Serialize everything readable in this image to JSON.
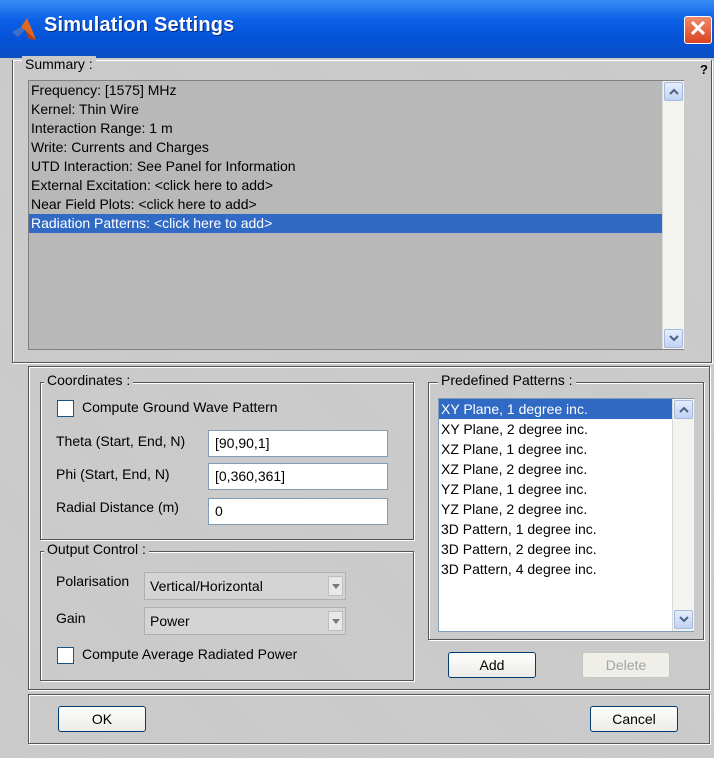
{
  "window": {
    "title": "Simulation Settings",
    "close_glyph": "✕"
  },
  "summary": {
    "legend": "Summary :",
    "help_glyph": "?",
    "items": [
      "Frequency: [1575] MHz",
      "Kernel: Thin Wire",
      "Interaction Range: 1 m",
      "Write: Currents and Charges",
      "UTD Interaction: See Panel for Information",
      "External Excitation: <click here to add>",
      "Near Field Plots: <click here to add>",
      "Radiation Patterns: <click here to add>"
    ],
    "selected_index": 7
  },
  "coordinates": {
    "legend": "Coordinates :",
    "ground_wave_label": "Compute Ground Wave Pattern",
    "theta_label": "Theta (Start, End, N)",
    "theta_value": "[90,90,1]",
    "phi_label": "Phi (Start, End, N)",
    "phi_value": "[0,360,361]",
    "radial_label": "Radial Distance (m)",
    "radial_value": "0"
  },
  "output_control": {
    "legend": "Output Control :",
    "polarisation_label": "Polarisation",
    "polarisation_value": "Vertical/Horizontal",
    "gain_label": "Gain",
    "gain_value": "Power",
    "avg_power_label": "Compute Average Radiated Power"
  },
  "predefined": {
    "legend": "Predefined Patterns :",
    "items": [
      "XY Plane, 1 degree inc.",
      "XY Plane, 2 degree inc.",
      "XZ Plane, 1 degree inc.",
      "XZ Plane, 2 degree inc.",
      "YZ Plane, 1 degree inc.",
      "YZ Plane, 2 degree inc.",
      "3D Pattern, 1 degree inc.",
      "3D Pattern, 2 degree inc.",
      "3D Pattern, 4 degree inc."
    ],
    "selected_index": 0,
    "add_label": "Add",
    "delete_label": "Delete"
  },
  "footer": {
    "ok_label": "OK",
    "cancel_label": "Cancel"
  },
  "colors": {
    "selection": "#316ac5",
    "titlebar": "#0a5fe6"
  }
}
